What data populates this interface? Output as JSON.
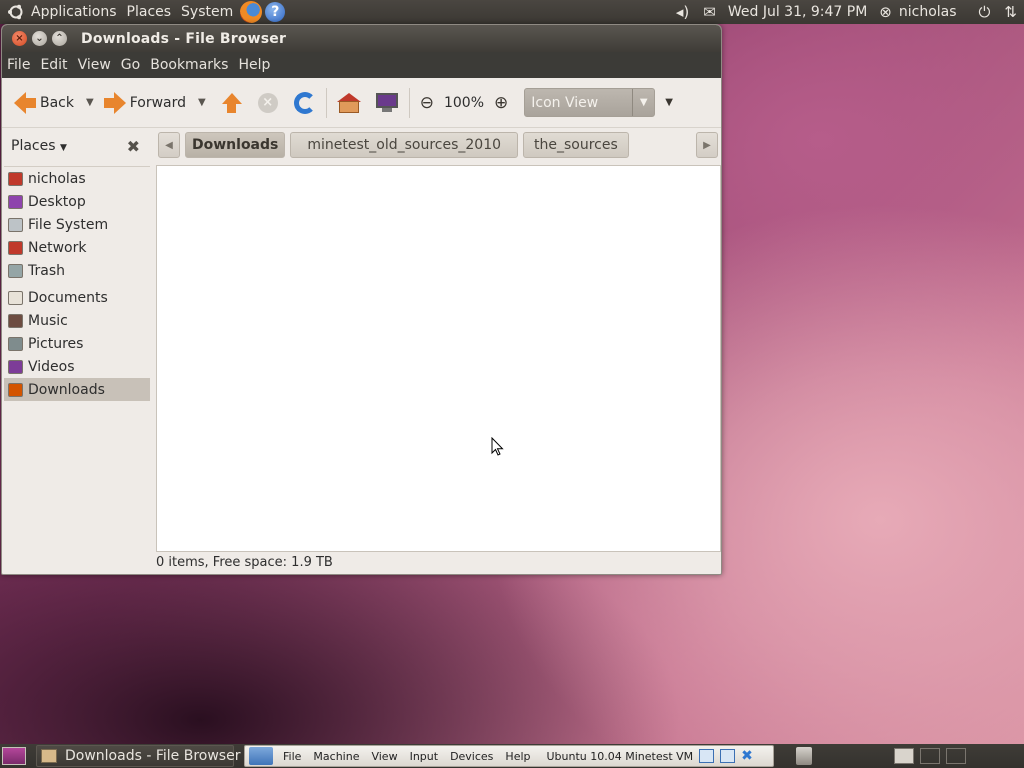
{
  "top_panel": {
    "menus": [
      "Applications",
      "Places",
      "System"
    ],
    "clock": "Wed Jul 31,  9:47 PM",
    "user": "nicholas"
  },
  "window": {
    "title": "Downloads - File Browser",
    "menubar": [
      "File",
      "Edit",
      "View",
      "Go",
      "Bookmarks",
      "Help"
    ],
    "toolbar": {
      "back": "Back",
      "forward": "Forward",
      "zoom": "100%",
      "view_mode": "Icon View"
    },
    "sidebar": {
      "header": "Places",
      "items": [
        {
          "label": "nicholas",
          "color": "#c0392b"
        },
        {
          "label": "Desktop",
          "color": "#8e44ad"
        },
        {
          "label": "File System",
          "color": "#bdc3c7"
        },
        {
          "label": "Network",
          "color": "#c0392b"
        },
        {
          "label": "Trash",
          "color": "#95a5a6"
        },
        {
          "label": "Documents",
          "color": "#e8e2d8"
        },
        {
          "label": "Music",
          "color": "#6d4c41"
        },
        {
          "label": "Pictures",
          "color": "#7f8c8d"
        },
        {
          "label": "Videos",
          "color": "#7d3c98"
        },
        {
          "label": "Downloads",
          "color": "#d35400"
        }
      ],
      "selected": "Downloads"
    },
    "breadcrumbs": [
      "Downloads",
      "minetest_old_sources_2010",
      "the_sources"
    ],
    "status": "0 items, Free space: 1.9 TB"
  },
  "bottom_panel": {
    "task": "Downloads - File Browser",
    "vbox_menus": [
      "File",
      "Machine",
      "View",
      "Input",
      "Devices",
      "Help"
    ],
    "vbox_title": "Ubuntu 10.04 Minetest VM"
  }
}
